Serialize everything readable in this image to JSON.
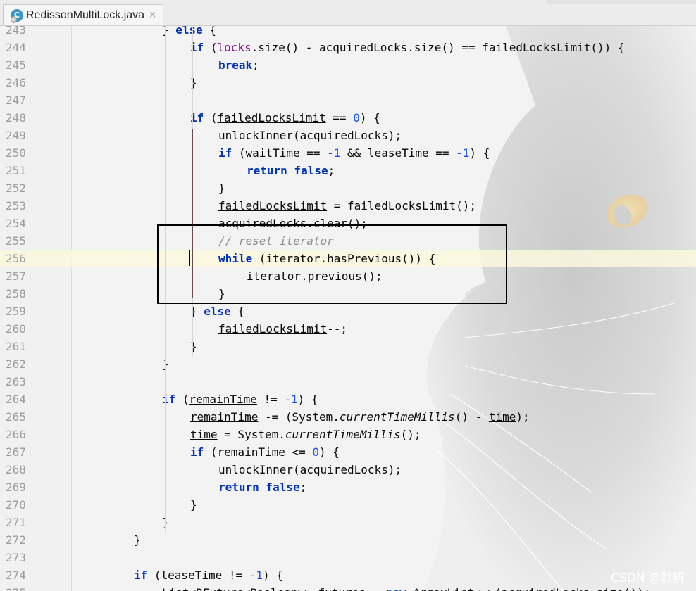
{
  "tab": {
    "label": "RedissonMultiLock.java",
    "icon": "java-class-icon",
    "icon_letter": "C",
    "close": "×"
  },
  "watermark": "CSDN @默辨",
  "colors": {
    "keyword": "#0033b3",
    "number": "#1750eb",
    "field": "#871094",
    "comment": "#8c8c8c",
    "caret_line": "#fcf8de"
  },
  "lines": [
    {
      "n": "243",
      "indent": 4,
      "segs": [
        {
          "t": "} "
        },
        {
          "t": "else",
          "c": "kw"
        },
        {
          "t": " {"
        }
      ]
    },
    {
      "n": "244",
      "indent": 5,
      "segs": [
        {
          "t": "if",
          "c": "kw"
        },
        {
          "t": " ("
        },
        {
          "t": "locks",
          "c": "fld"
        },
        {
          "t": ".size() - acquiredLocks.size() == failedLocksLimit()) {"
        }
      ]
    },
    {
      "n": "245",
      "indent": 6,
      "segs": [
        {
          "t": "break",
          "c": "kw"
        },
        {
          "t": ";"
        }
      ]
    },
    {
      "n": "246",
      "indent": 5,
      "segs": [
        {
          "t": "}"
        }
      ]
    },
    {
      "n": "247",
      "indent": 0,
      "segs": []
    },
    {
      "n": "248",
      "indent": 5,
      "segs": [
        {
          "t": "if",
          "c": "kw"
        },
        {
          "t": " ("
        },
        {
          "t": "failedLocksLimit",
          "c": "und"
        },
        {
          "t": " == "
        },
        {
          "t": "0",
          "c": "num"
        },
        {
          "t": ") {"
        }
      ]
    },
    {
      "n": "249",
      "indent": 6,
      "segs": [
        {
          "t": "unlockInner(acquiredLocks);"
        }
      ]
    },
    {
      "n": "250",
      "indent": 6,
      "segs": [
        {
          "t": "if",
          "c": "kw"
        },
        {
          "t": " (waitTime == "
        },
        {
          "t": "-1",
          "c": "num"
        },
        {
          "t": " && leaseTime == "
        },
        {
          "t": "-1",
          "c": "num"
        },
        {
          "t": ") {"
        }
      ]
    },
    {
      "n": "251",
      "indent": 7,
      "segs": [
        {
          "t": "return false",
          "c": "kw"
        },
        {
          "t": ";"
        }
      ]
    },
    {
      "n": "252",
      "indent": 6,
      "segs": [
        {
          "t": "}"
        }
      ]
    },
    {
      "n": "253",
      "indent": 6,
      "segs": [
        {
          "t": "failedLocksLimit",
          "c": "und"
        },
        {
          "t": " = failedLocksLimit();"
        }
      ]
    },
    {
      "n": "254",
      "indent": 6,
      "segs": [
        {
          "t": "acquiredLocks.clear();"
        }
      ]
    },
    {
      "n": "255",
      "indent": 6,
      "segs": [
        {
          "t": "// reset iterator",
          "c": "cmt"
        }
      ]
    },
    {
      "n": "256",
      "indent": 6,
      "caret": true,
      "segs": [
        {
          "t": "while",
          "c": "kw"
        },
        {
          "t": " (iterator.hasPrevious()) {"
        }
      ]
    },
    {
      "n": "257",
      "indent": 7,
      "segs": [
        {
          "t": "iterator.previous();"
        }
      ]
    },
    {
      "n": "258",
      "indent": 6,
      "segs": [
        {
          "t": "}"
        }
      ]
    },
    {
      "n": "259",
      "indent": 5,
      "segs": [
        {
          "t": "} "
        },
        {
          "t": "else",
          "c": "kw"
        },
        {
          "t": " {"
        }
      ]
    },
    {
      "n": "260",
      "indent": 6,
      "segs": [
        {
          "t": "failedLocksLimit",
          "c": "und"
        },
        {
          "t": "--;"
        }
      ]
    },
    {
      "n": "261",
      "indent": 5,
      "segs": [
        {
          "t": "}"
        }
      ]
    },
    {
      "n": "262",
      "indent": 4,
      "segs": [
        {
          "t": "}"
        }
      ]
    },
    {
      "n": "263",
      "indent": 0,
      "segs": []
    },
    {
      "n": "264",
      "indent": 4,
      "segs": [
        {
          "t": "if",
          "c": "kw"
        },
        {
          "t": " ("
        },
        {
          "t": "remainTime",
          "c": "und"
        },
        {
          "t": " != "
        },
        {
          "t": "-1",
          "c": "num"
        },
        {
          "t": ") {"
        }
      ]
    },
    {
      "n": "265",
      "indent": 5,
      "segs": [
        {
          "t": "remainTime",
          "c": "und"
        },
        {
          "t": " -= (System."
        },
        {
          "t": "currentTimeMillis",
          "c": "ital"
        },
        {
          "t": "() - "
        },
        {
          "t": "time",
          "c": "und"
        },
        {
          "t": ");"
        }
      ]
    },
    {
      "n": "266",
      "indent": 5,
      "segs": [
        {
          "t": "time",
          "c": "und"
        },
        {
          "t": " = System."
        },
        {
          "t": "currentTimeMillis",
          "c": "ital"
        },
        {
          "t": "();"
        }
      ]
    },
    {
      "n": "267",
      "indent": 5,
      "segs": [
        {
          "t": "if",
          "c": "kw"
        },
        {
          "t": " ("
        },
        {
          "t": "remainTime",
          "c": "und"
        },
        {
          "t": " <= "
        },
        {
          "t": "0",
          "c": "num"
        },
        {
          "t": ") {"
        }
      ]
    },
    {
      "n": "268",
      "indent": 6,
      "segs": [
        {
          "t": "unlockInner(acquiredLocks);"
        }
      ]
    },
    {
      "n": "269",
      "indent": 6,
      "segs": [
        {
          "t": "return false",
          "c": "kw"
        },
        {
          "t": ";"
        }
      ]
    },
    {
      "n": "270",
      "indent": 5,
      "segs": [
        {
          "t": "}"
        }
      ]
    },
    {
      "n": "271",
      "indent": 4,
      "segs": [
        {
          "t": "}"
        }
      ]
    },
    {
      "n": "272",
      "indent": 3,
      "segs": [
        {
          "t": "}"
        }
      ]
    },
    {
      "n": "273",
      "indent": 0,
      "segs": []
    },
    {
      "n": "274",
      "indent": 3,
      "segs": [
        {
          "t": "if",
          "c": "kw"
        },
        {
          "t": " (leaseTime != "
        },
        {
          "t": "-1",
          "c": "num"
        },
        {
          "t": ") {"
        }
      ]
    },
    {
      "n": "275",
      "indent": 4,
      "segs": [
        {
          "t": "List<RFuture<Boolean>> futures = "
        },
        {
          "t": "new",
          "c": "kw"
        },
        {
          "t": " ArrayList<~>(acquiredLocks.size());"
        }
      ]
    }
  ]
}
